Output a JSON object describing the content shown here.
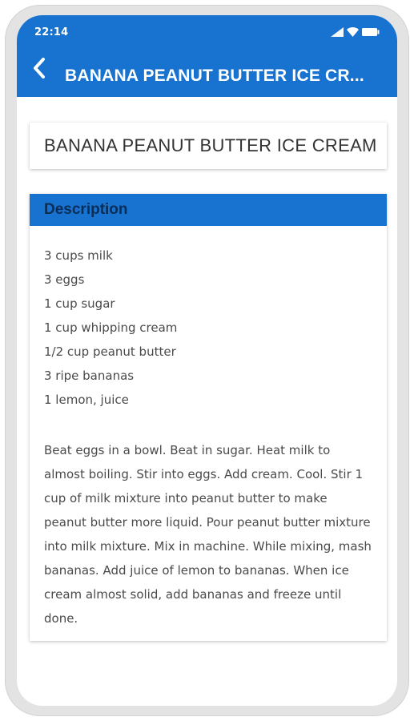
{
  "status_bar": {
    "time": "22:14",
    "icons": [
      "signal-icon",
      "wifi-icon",
      "battery-icon"
    ]
  },
  "app_bar": {
    "back_icon": "chevron-left-icon",
    "title": "BANANA PEANUT BUTTER ICE CR..."
  },
  "recipe": {
    "title": "BANANA PEANUT BUTTER ICE CREAM",
    "description_header": "Description",
    "ingredients": [
      "3 cups milk",
      "3 eggs",
      "1 cup sugar",
      "1 cup whipping cream",
      "1/2 cup peanut butter",
      "3 ripe bananas",
      "1 lemon, juice"
    ],
    "instructions": "Beat eggs in a bowl. Beat in sugar. Heat milk to almost boiling. Stir into eggs. Add cream. Cool. Stir 1 cup of milk mixture into peanut butter to make peanut butter more liquid. Pour peanut butter mixture into milk mixture. Mix in machine. While mixing, mash bananas. Add juice of lemon to bananas. When ice cream almost solid, add bananas and freeze until done."
  },
  "colors": {
    "accent": "#1772d0",
    "header_text": "#0b2e57",
    "body_text": "#4a4a4a"
  }
}
